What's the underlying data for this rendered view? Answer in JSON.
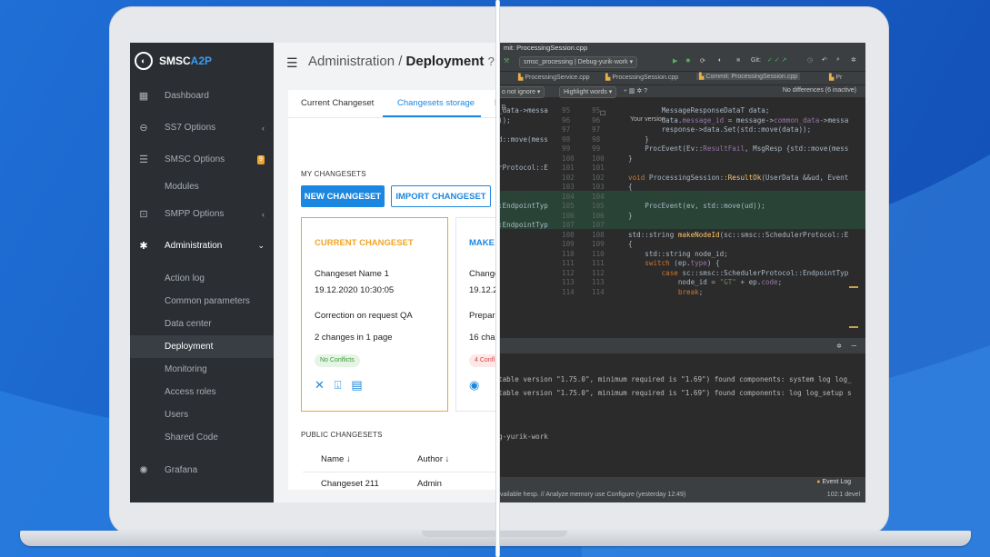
{
  "sidebar": {
    "brand_a": "SMSC",
    "brand_b": "A2P",
    "items": [
      {
        "label": "Dashboard"
      },
      {
        "label": "SS7 Options"
      },
      {
        "label": "SMSC Options",
        "badge": "9"
      },
      {
        "label": "Modules"
      },
      {
        "label": "SMPP Options"
      },
      {
        "label": "Administration"
      },
      {
        "label": "Action log"
      },
      {
        "label": "Common parameters"
      },
      {
        "label": "Data center"
      },
      {
        "label": "Deployment"
      },
      {
        "label": "Monitoring"
      },
      {
        "label": "Access roles"
      },
      {
        "label": "Users"
      },
      {
        "label": "Shared Code"
      },
      {
        "label": "Grafana"
      }
    ]
  },
  "header": {
    "section": "Administration /",
    "page": "Deployment",
    "help": "?"
  },
  "tabs": [
    {
      "label": "Current Changeset"
    },
    {
      "label": "Changesets storage"
    },
    {
      "label": "D"
    }
  ],
  "my_changesets": {
    "title": "MY CHANGESETS",
    "new_btn": "NEW CHANGESET",
    "import_btn": "IMPORT CHANGESET"
  },
  "cards": [
    {
      "title": "CURRENT CHANGESET",
      "name": "Changeset Name 1",
      "date": "19.12.2020 10:30:05",
      "desc": "Correction on request QA",
      "changes": "2 changes in 1 page",
      "chip": "No Conflicts"
    },
    {
      "title": "MAKE",
      "name": "Change",
      "date": "19.12.2",
      "desc": "Prepara",
      "changes": "16 char",
      "chip": "4 Confl"
    }
  ],
  "public": {
    "title": "PUBLIC CHANGESETS",
    "col_name": "Name ↓",
    "col_author": "Author ↓",
    "row_name": "Changeset 211",
    "row_author": "Admin"
  },
  "ide": {
    "title": "mit: ProcessingSession.cpp",
    "toolbar": "smsc_processing | Debug-yurik-work ▾",
    "git": "Git:",
    "tab1": "ProcessingService.cpp",
    "tab2": "ProcessingSession.cpp",
    "tab3": "Commit: ProcessingSession.cpp",
    "tab4": "Pr",
    "ignore": "o not ignore ▾",
    "highlight": "Highlight words ▾",
    "nodiff": "No differences (6 inactive)",
    "your_version": "Your version",
    "p_label": "p",
    "code_left": [
      "",
      "_data->messa",
      "));",
      "",
      "d::move(mess",
      "",
      "",
      "rProtocol::E",
      "",
      "",
      "",
      ":EndpointTyp",
      "",
      ":EndpointTyp",
      "",
      "",
      "",
      "",
      ""
    ],
    "nums_left": [
      "",
      "95",
      "96",
      "97",
      "98",
      "99",
      "100",
      "101",
      "102",
      "103",
      "104",
      "105",
      "106",
      "107",
      "108",
      "109",
      "110",
      "111",
      "112",
      "113",
      "114"
    ],
    "nums_right": [
      "",
      "95",
      "96",
      "97",
      "98",
      "99",
      "100",
      "101",
      "102",
      "103",
      "104",
      "105",
      "106",
      "107",
      "108",
      "109",
      "110",
      "111",
      "112",
      "113",
      "114"
    ],
    "output": [
      "table version \"1.75.0\", minimum required is \"1.69\") found components: system log log_",
      "table version \"1.75.0\", minimum required is \"1.69\") found components: log log_setup s",
      "g-yurik-work"
    ],
    "event_log": "Event Log",
    "status_left": "vailable hesp. // Analyze memory use  Configure (yesterday 12:49)",
    "status_right": "102:1  devel"
  }
}
